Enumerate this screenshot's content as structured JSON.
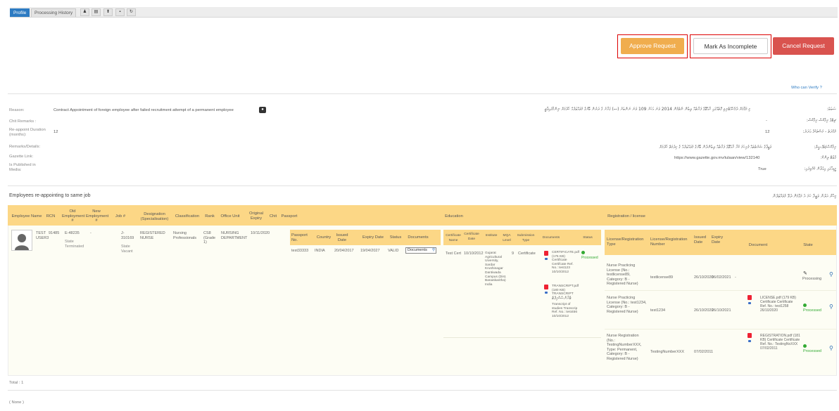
{
  "tabs": [
    {
      "label": "Profile",
      "active": true
    },
    {
      "label": "Processing History",
      "active": false
    }
  ],
  "tab_icons": [
    "person-icon",
    "book-icon",
    "upload-icon",
    "chat-icon",
    "undo-icon"
  ],
  "tab_icon_glyphs": [
    "♟",
    "▤",
    "⬆",
    "▪",
    "↻"
  ],
  "actions": {
    "approve": "Approve Request",
    "incomplete": "Mark As Incomplete",
    "cancel": "Cancel Request",
    "who_verify": "Who can Verify ?"
  },
  "details": {
    "reason_label": "Reason:",
    "reason_value": "Contract Appointment of foreign employee after failed recruitment attempt of a permanent employee",
    "chit_label": "Chit Remarks :",
    "duration_label": "Re-appoint Duration (months):",
    "duration_value": "12",
    "remarks_label": "Remarks/Details:",
    "gazette_label": "Gazette Link:",
    "media_label": "Is Published in Media:",
    "rtl_reason_label": "ސަބަބު:",
    "rtl_reason_value": "މި މަޤާމަށް ދެމެހެއްޓެނިވި ގޮތެއްގައި ރާއްޖޭގެ ފަރާތެއް ލިބެން ނެތުމުން 2014 ވަނަ އަހަރު 109 ވަނަ ނަންބަރު (ސ) ގަރާރު ގެ ދަށުން ބޭރުގެ މުވައްޒަފެއް ހޯދުމަށް ނިންމާފައިވާތީ",
    "rtl_chit_label": "ޗިޓްގެ ރިމާކްސް ރިމާކްސް:",
    "rtl_chit_value": "-",
    "rtl_duration_label": "މުއްދަތު - މަސްތަކުގެ ޢަދަދު:",
    "rtl_duration_value": "12",
    "rtl_remarks_label": "ރިމާކްސް/ތަފްސީލް:",
    "rtl_remarks_value": "ވަޒީފާގެ ޝަރުތުތައް ފުރިހަމަ ކުރާ ރާއްޖޭގެ ފަރާތެއް ލިބެންދެން ބޭރުގެ މުވައްޒަފެއް ގެ ޚިދުމަތް ހޯދުމަށް",
    "rtl_gazette_label": "ގެޒެޓް ލިންކް:",
    "rtl_gazette_value": "https://www.gazette.gov.mv/iulaan/view/132140",
    "rtl_media_label": "މީޑިއާގައި އިޢުލާން ކުރެވިފައި:",
    "rtl_media_value": "True"
  },
  "section": {
    "title": "Employees re-appointing to same job",
    "rtl_title": "މިހާރު އަލުން ވަޒީފާ ހަމަ އެ މަގާމަށް ދެވޭ މުވައްޒަފުން"
  },
  "table": {
    "headers": [
      "Employee Name",
      "RCN",
      "Old Employment #",
      "New Employment #",
      "Job #",
      "Designation (Specialisation)",
      "Classification",
      "Rank",
      "Office Unit",
      "Original Expiry",
      "Chit",
      "Passport",
      "Education",
      "Registration / license"
    ],
    "passport_headers": [
      "Passport No.",
      "Country",
      "Issued Date",
      "Expiry Date",
      "Status",
      "Documents"
    ],
    "education_headers": [
      "Certificate Name",
      "Certificate Date",
      "Institute",
      "MQA Level",
      "Submission Type",
      "Documents",
      "Status"
    ],
    "registration_headers": [
      "License/Registration Type",
      "License/Registration Number",
      "Issued Date",
      "Expiry Date",
      "Document",
      "State"
    ],
    "row": {
      "employee_name": "TEST USER3",
      "rcn": "91485",
      "old_emp": "E-48235",
      "old_emp_state": "State Terminated",
      "new_emp": "-",
      "job": "J-310169",
      "job_state": "State Vacant",
      "designation": "REGISTERED NURSE",
      "classification": "Nursing Professionals",
      "rank": "CS8 (Grade 1)",
      "office_unit": "NURSING DEPARTMENT",
      "original_expiry": "10/11/2020",
      "passport_no": "test33333",
      "country": "INDIA",
      "issued": "20/04/2017",
      "expiry": "19/04/2027",
      "status": "VALID",
      "documents_btn": "Documents",
      "edu_name": "Test Cert",
      "edu_date": "10/10/2012",
      "edu_institute": "Gujarat Agricultural Uiversity, Sardar Krushinagar Dantiwada Campus (Dist. Banaskantha) India",
      "edu_level": "9",
      "edu_type": "Certificate",
      "edu_doc1": "CERTIFICATE.pdf (175 KB) Certificate Certifcate Ref. No.: test123 10/10/2012",
      "edu_doc2": "TRANSCRIPT.pdf (180 KB) TRANSCRIPT",
      "edu_doc2_rtl": "ޓްރާންސްކްރިޕްޓް",
      "edu_doc2_tail": "Transcript of studies Transcrip Ref. No.: test456 10/10/2012",
      "edu_status": "Processed",
      "reg": [
        {
          "type": "Nurse Practicing License (No.: testlicense89, Category: B - Registered Nurse)",
          "number": "testlicense89",
          "issued": "26/10/2020",
          "expiry": "06/02/2021",
          "doc": "-",
          "state": "Processing"
        },
        {
          "type": "Nurse Practicing License (No.: test1234, Category: B - Registered Nurse)",
          "number": "test1234",
          "issued": "26/10/2020",
          "expiry": "26/10/2021",
          "doc": "LICENSE.pdf (179 KB) Certificate Certificate Ref. No.: test1258 26/10/2020",
          "state": "Processed"
        },
        {
          "type": "Nurse Registration (No.: TestingNumberXXX, Type: Permanent, Category: B - Registered Nurse)",
          "number": "TestingNumberXXX",
          "issued": "07/02/2011",
          "expiry": "",
          "doc": "REGISTRATION.pdf (181 KB) Certificate Certificate Ref. No.: TestingNoXXX 07/02/2011",
          "state": "Processed"
        }
      ]
    },
    "total": "Total : 1"
  },
  "footer_note": "( None )"
}
